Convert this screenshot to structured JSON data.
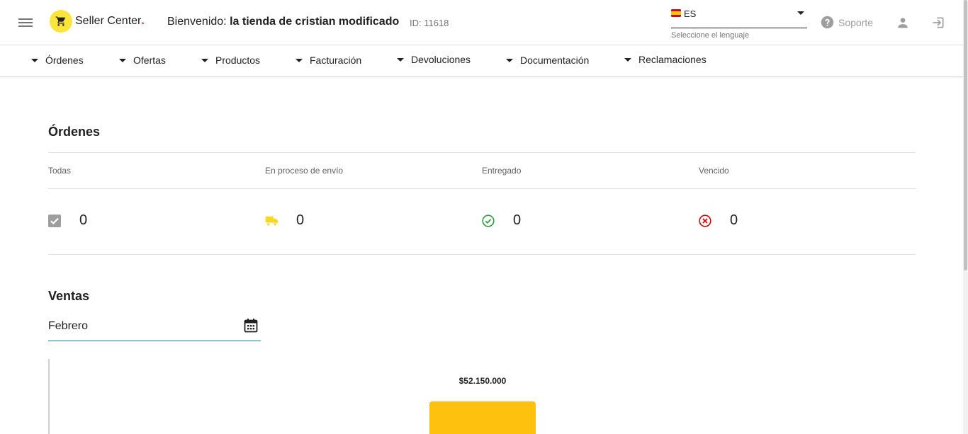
{
  "header": {
    "logo_text": "Seller Center",
    "logo_dot": ".",
    "welcome_prefix": "Bienvenido:",
    "store_name": "la tienda de cristian modificado",
    "store_id": "ID: 11618",
    "language": {
      "code": "ES",
      "helper": "Seleccione el lenguaje"
    },
    "support_label": "Soporte"
  },
  "nav": {
    "items": [
      {
        "label": "Órdenes"
      },
      {
        "label": "Ofertas"
      },
      {
        "label": "Productos"
      },
      {
        "label": "Facturación"
      },
      {
        "label": "Devoluciones"
      },
      {
        "label": "Documentación"
      },
      {
        "label": "Reclamaciones"
      }
    ]
  },
  "orders": {
    "title": "Órdenes",
    "columns": [
      {
        "label": "Todas",
        "value": "0",
        "icon": "checkbox-icon"
      },
      {
        "label": "En proceso de envío",
        "value": "0",
        "icon": "truck-icon"
      },
      {
        "label": "Entregado",
        "value": "0",
        "icon": "check-circle-icon"
      },
      {
        "label": "Vencido",
        "value": "0",
        "icon": "cancel-circle-icon"
      }
    ]
  },
  "sales": {
    "title": "Ventas",
    "month": "Febrero",
    "bar_label": "$52.150.000"
  },
  "colors": {
    "logo_yellow": "#fce43a",
    "bar_yellow": "#fdc10e",
    "truck_yellow": "#f9d71c",
    "success_green": "#2e9e3e",
    "error_red": "#d50000",
    "field_underline": "#1a7f8e"
  }
}
